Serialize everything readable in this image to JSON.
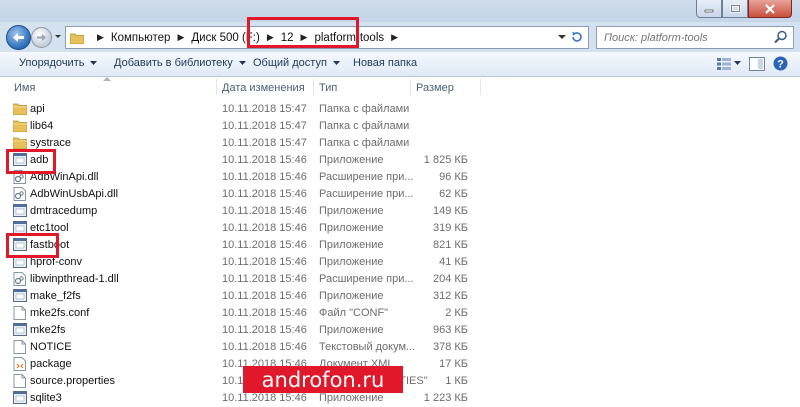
{
  "window": {
    "controls": [
      "minimize",
      "maximize",
      "close"
    ]
  },
  "address": {
    "segments": [
      "Компьютер",
      "Диск 500 (F:)",
      "12",
      "platform-tools"
    ],
    "highlight_segment": "platform-tools"
  },
  "search": {
    "placeholder": "Поиск: platform-tools"
  },
  "toolbar": {
    "organize": "Упорядочить",
    "add_library": "Добавить в библиотеку",
    "share": "Общий доступ",
    "new_folder": "Новая папка",
    "icons": [
      "view-options-icon",
      "preview-pane-icon",
      "help-icon"
    ]
  },
  "columns": {
    "name": "Имя",
    "date": "Дата изменения",
    "type": "Тип",
    "size": "Размер"
  },
  "files": [
    {
      "name": "api",
      "date": "10.11.2018 15:47",
      "type": "Папка с файлами",
      "size": "",
      "icon": "folder-icon"
    },
    {
      "name": "lib64",
      "date": "10.11.2018 15:47",
      "type": "Папка с файлами",
      "size": "",
      "icon": "folder-icon"
    },
    {
      "name": "systrace",
      "date": "10.11.2018 15:47",
      "type": "Папка с файлами",
      "size": "",
      "icon": "folder-icon"
    },
    {
      "name": "adb",
      "date": "10.11.2018 15:46",
      "type": "Приложение",
      "size": "1 825 КБ",
      "icon": "app-icon",
      "highlight": true
    },
    {
      "name": "AdbWinApi.dll",
      "date": "10.11.2018 15:46",
      "type": "Расширение при...",
      "size": "96 КБ",
      "icon": "dll-icon"
    },
    {
      "name": "AdbWinUsbApi.dll",
      "date": "10.11.2018 15:46",
      "type": "Расширение при...",
      "size": "62 КБ",
      "icon": "dll-icon"
    },
    {
      "name": "dmtracedump",
      "date": "10.11.2018 15:46",
      "type": "Приложение",
      "size": "149 КБ",
      "icon": "app-icon"
    },
    {
      "name": "etc1tool",
      "date": "10.11.2018 15:46",
      "type": "Приложение",
      "size": "319 КБ",
      "icon": "app-icon"
    },
    {
      "name": "fastboot",
      "date": "10.11.2018 15:46",
      "type": "Приложение",
      "size": "821 КБ",
      "icon": "app-icon",
      "highlight": true
    },
    {
      "name": "hprof-conv",
      "date": "10.11.2018 15:46",
      "type": "Приложение",
      "size": "41 КБ",
      "icon": "app-icon"
    },
    {
      "name": "libwinpthread-1.dll",
      "date": "10.11.2018 15:46",
      "type": "Расширение при...",
      "size": "204 КБ",
      "icon": "dll-icon"
    },
    {
      "name": "make_f2fs",
      "date": "10.11.2018 15:46",
      "type": "Приложение",
      "size": "312 КБ",
      "icon": "app-icon"
    },
    {
      "name": "mke2fs.conf",
      "date": "10.11.2018 15:46",
      "type": "Файл \"CONF\"",
      "size": "2 КБ",
      "icon": "file-icon"
    },
    {
      "name": "mke2fs",
      "date": "10.11.2018 15:46",
      "type": "Приложение",
      "size": "963 КБ",
      "icon": "app-icon"
    },
    {
      "name": "NOTICE",
      "date": "10.11.2018 15:46",
      "type": "Текстовый докум...",
      "size": "378 КБ",
      "icon": "file-icon"
    },
    {
      "name": "package",
      "date": "10.11.2018 15:46",
      "type": "Документ XML",
      "size": "17 КБ",
      "icon": "xml-icon"
    },
    {
      "name": "source.properties",
      "date": "10.11.2018 15:46",
      "type": "Файл \"PROPERTIES\"",
      "size": "1 КБ",
      "icon": "file-icon"
    },
    {
      "name": "sqlite3",
      "date": "10.11.2018 15:46",
      "type": "Приложение",
      "size": "1 223 КБ",
      "icon": "app-icon"
    }
  ],
  "watermark": {
    "text": "androfon.ru"
  },
  "colors": {
    "highlight": "#e0182a",
    "toolbar_text": "#1e395b",
    "secondary_text": "#6d6d6d"
  }
}
